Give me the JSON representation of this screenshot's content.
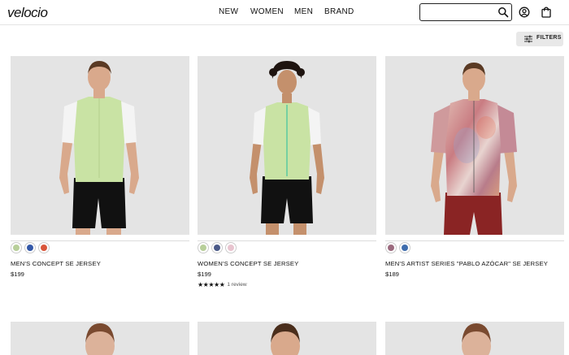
{
  "header": {
    "logo_text": "velocio",
    "nav": [
      {
        "label": "NEW"
      },
      {
        "label": "WOMEN"
      },
      {
        "label": "MEN"
      },
      {
        "label": "BRAND"
      }
    ],
    "search": {
      "placeholder": "",
      "value": ""
    }
  },
  "toolbar": {
    "filters_label": "FILTERS"
  },
  "products": [
    {
      "name": "MEN'S CONCEPT SE JERSEY",
      "price": "$199",
      "swatches": [
        "#b8cf9a",
        "#3358a8",
        "#d9553a"
      ],
      "jersey_color": "#c9e3a4",
      "sleeve_color": "#ffffff",
      "shorts_color": "#111111"
    },
    {
      "name": "WOMEN'S CONCEPT SE JERSEY",
      "price": "$199",
      "swatches": [
        "#b8cf9a",
        "#4b5a88",
        "#e8c4cf"
      ],
      "rating_stars": "★★★★★",
      "review_count": "1 review",
      "jersey_color": "#c9e3a4",
      "sleeve_color": "#ffffff",
      "shorts_color": "#111111"
    },
    {
      "name": "MEN'S ARTIST SERIES \"PABLO AZÓCAR\" SE JERSEY",
      "price": "$189",
      "swatches": [
        "#9b6a7e",
        "#3f6dad"
      ],
      "jersey_color": "#d9a6a8",
      "sleeve_color": "#c98b8e",
      "shorts_color": "#8a2424"
    }
  ],
  "colors": {
    "image_bg": "#e6e6e6",
    "skin": "#d9a98c",
    "hair": "#5a3a24"
  }
}
